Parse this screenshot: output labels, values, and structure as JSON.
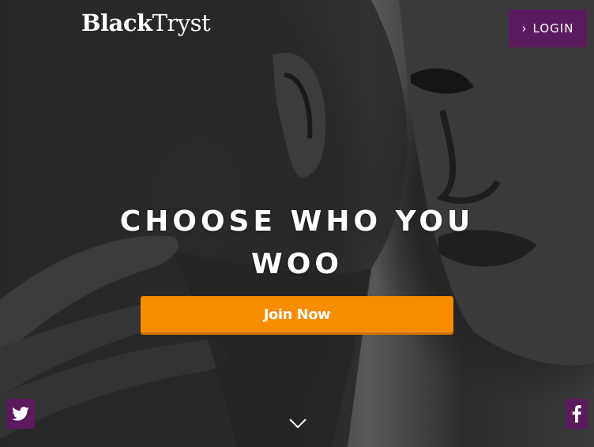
{
  "header": {
    "brand_part1": "Black",
    "brand_part2": "Tryst",
    "login_label": "LOGIN"
  },
  "hero": {
    "headline": "CHOOSE WHO YOU WOO",
    "cta_label": "Join Now"
  },
  "social": {
    "twitter_icon": "twitter-icon",
    "facebook_icon": "facebook-icon"
  },
  "colors": {
    "brand_purple": "#5c1a5e",
    "cta_orange": "#fa8c00"
  }
}
